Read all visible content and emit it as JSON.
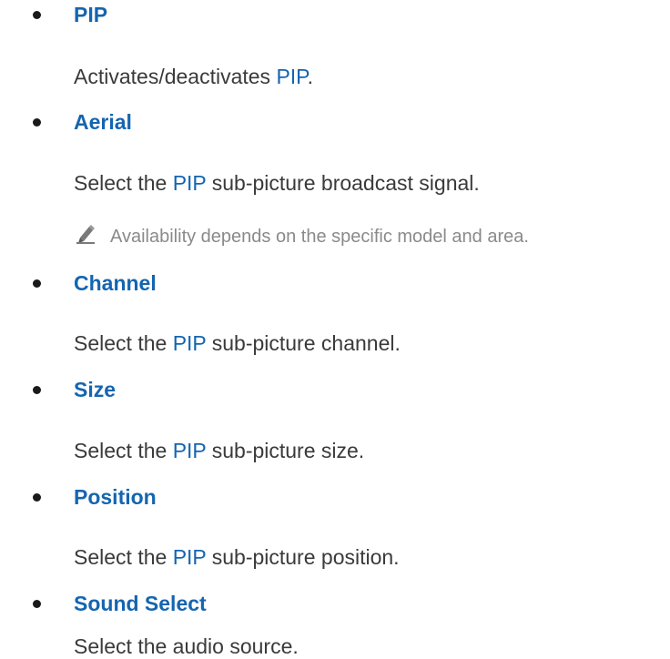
{
  "colors": {
    "accent": "#1565b0",
    "body_text": "#3a3a3a",
    "note_text": "#8a8a8a",
    "bullet": "#1a1a1a"
  },
  "items": [
    {
      "title": "PIP",
      "desc_before": "Activates/deactivates ",
      "desc_highlight": "PIP",
      "desc_after": "."
    },
    {
      "title": "Aerial",
      "desc_before": "Select the ",
      "desc_highlight": "PIP",
      "desc_after": " sub-picture broadcast signal.",
      "note": {
        "icon": "pencil-icon",
        "text": "Availability depends on the specific model and area."
      }
    },
    {
      "title": "Channel",
      "desc_before": "Select the ",
      "desc_highlight": "PIP",
      "desc_after": " sub-picture channel."
    },
    {
      "title": "Size",
      "desc_before": "Select the ",
      "desc_highlight": "PIP",
      "desc_after": " sub-picture size."
    },
    {
      "title": "Position",
      "desc_before": "Select the ",
      "desc_highlight": "PIP",
      "desc_after": " sub-picture position."
    },
    {
      "title": "Sound Select",
      "desc_before": "Select the audio source.",
      "desc_highlight": "",
      "desc_after": ""
    }
  ]
}
